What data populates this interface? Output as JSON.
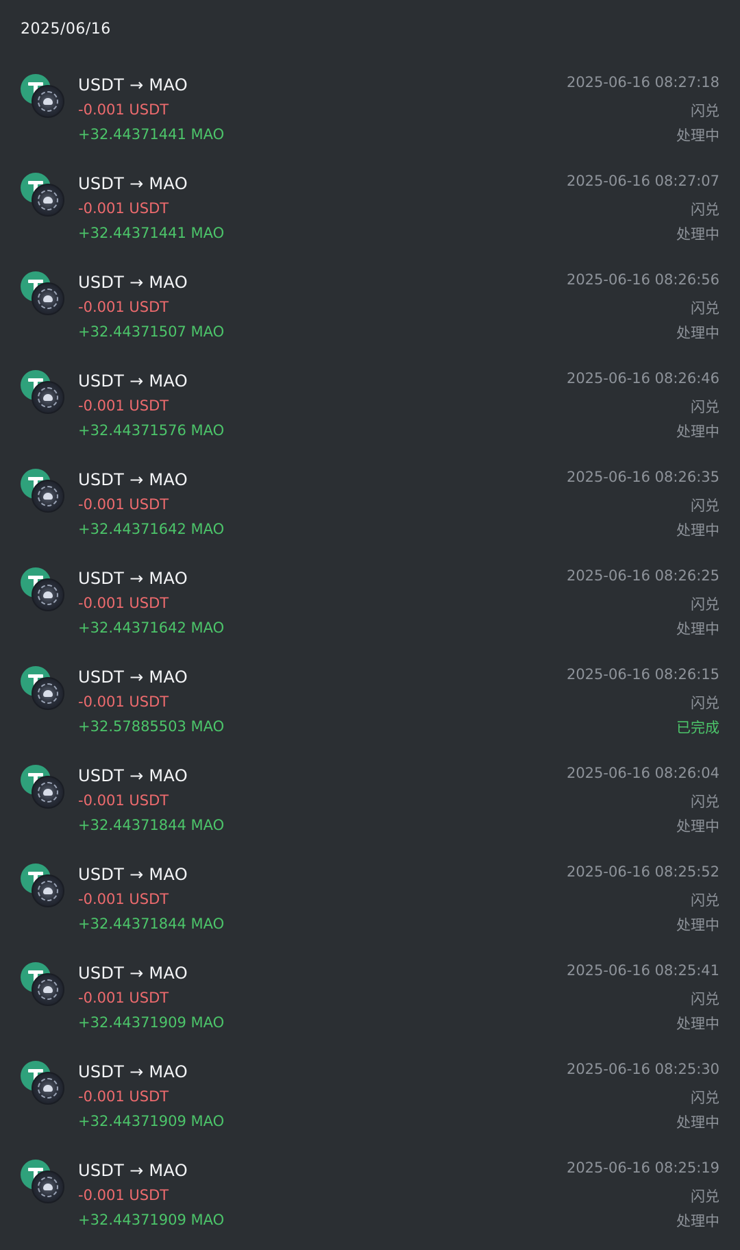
{
  "header": {
    "date": "2025/06/16"
  },
  "colors": {
    "background": "#2b2f33",
    "negative": "#ee6b6e",
    "positive": "#4cc56a",
    "muted": "#8e939a",
    "usdt_green": "#2fa17b"
  },
  "icons": {
    "from": "usdt-icon",
    "to": "mao-icon"
  },
  "transactions": [
    {
      "pair": "USDT → MAO",
      "out": "-0.001 USDT",
      "in": "+32.44371441 MAO",
      "time": "2025-06-16 08:27:18",
      "type": "闪兑",
      "status": "处理中",
      "status_done": false
    },
    {
      "pair": "USDT → MAO",
      "out": "-0.001 USDT",
      "in": "+32.44371441 MAO",
      "time": "2025-06-16 08:27:07",
      "type": "闪兑",
      "status": "处理中",
      "status_done": false
    },
    {
      "pair": "USDT → MAO",
      "out": "-0.001 USDT",
      "in": "+32.44371507 MAO",
      "time": "2025-06-16 08:26:56",
      "type": "闪兑",
      "status": "处理中",
      "status_done": false
    },
    {
      "pair": "USDT → MAO",
      "out": "-0.001 USDT",
      "in": "+32.44371576 MAO",
      "time": "2025-06-16 08:26:46",
      "type": "闪兑",
      "status": "处理中",
      "status_done": false
    },
    {
      "pair": "USDT → MAO",
      "out": "-0.001 USDT",
      "in": "+32.44371642 MAO",
      "time": "2025-06-16 08:26:35",
      "type": "闪兑",
      "status": "处理中",
      "status_done": false
    },
    {
      "pair": "USDT → MAO",
      "out": "-0.001 USDT",
      "in": "+32.44371642 MAO",
      "time": "2025-06-16 08:26:25",
      "type": "闪兑",
      "status": "处理中",
      "status_done": false
    },
    {
      "pair": "USDT → MAO",
      "out": "-0.001 USDT",
      "in": "+32.57885503 MAO",
      "time": "2025-06-16 08:26:15",
      "type": "闪兑",
      "status": "已完成",
      "status_done": true
    },
    {
      "pair": "USDT → MAO",
      "out": "-0.001 USDT",
      "in": "+32.44371844 MAO",
      "time": "2025-06-16 08:26:04",
      "type": "闪兑",
      "status": "处理中",
      "status_done": false
    },
    {
      "pair": "USDT → MAO",
      "out": "-0.001 USDT",
      "in": "+32.44371844 MAO",
      "time": "2025-06-16 08:25:52",
      "type": "闪兑",
      "status": "处理中",
      "status_done": false
    },
    {
      "pair": "USDT → MAO",
      "out": "-0.001 USDT",
      "in": "+32.44371909 MAO",
      "time": "2025-06-16 08:25:41",
      "type": "闪兑",
      "status": "处理中",
      "status_done": false
    },
    {
      "pair": "USDT → MAO",
      "out": "-0.001 USDT",
      "in": "+32.44371909 MAO",
      "time": "2025-06-16 08:25:30",
      "type": "闪兑",
      "status": "处理中",
      "status_done": false
    },
    {
      "pair": "USDT → MAO",
      "out": "-0.001 USDT",
      "in": "+32.44371909 MAO",
      "time": "2025-06-16 08:25:19",
      "type": "闪兑",
      "status": "处理中",
      "status_done": false
    }
  ]
}
